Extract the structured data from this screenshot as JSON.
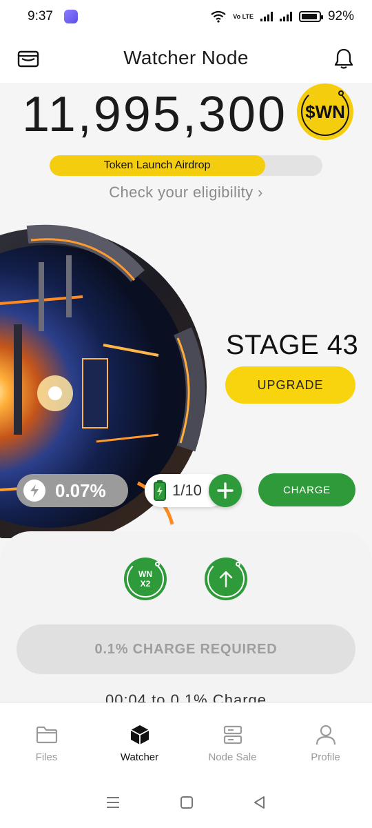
{
  "status_bar": {
    "time": "9:37",
    "volte_label": "Vo LTE",
    "battery_percent": "92%",
    "battery_level": 0.92
  },
  "header": {
    "title": "Watcher Node",
    "left_icon": "wallet-icon",
    "right_icon": "bell-icon"
  },
  "balance": {
    "amount": "11,995,300",
    "token_symbol": "$WN"
  },
  "airdrop": {
    "label": "Token Launch Airdrop",
    "progress": 0.79,
    "eligibility_text": "Check your eligibility",
    "eligibility_chevron": "›"
  },
  "stage": {
    "label": "STAGE 43",
    "upgrade_label": "UPGRADE"
  },
  "controls": {
    "energy_value": "0.07%",
    "battery_count": "1/10",
    "charge_label": "CHARGE"
  },
  "sheet": {
    "boost_top": "WN",
    "boost_bottom": "X2",
    "required_label": "0.1% CHARGE REQUIRED",
    "timer_text": "00:04  to 0.1% Charge"
  },
  "nav": {
    "items": [
      {
        "label": "Files",
        "icon": "folder-icon",
        "active": false
      },
      {
        "label": "Watcher",
        "icon": "cube-icon",
        "active": true
      },
      {
        "label": "Node Sale",
        "icon": "server-icon",
        "active": false
      },
      {
        "label": "Profile",
        "icon": "person-icon",
        "active": false
      }
    ]
  },
  "colors": {
    "accent_yellow": "#f5cd0f",
    "accent_green": "#2e9a3a",
    "muted_gray": "#9b9b9b"
  }
}
